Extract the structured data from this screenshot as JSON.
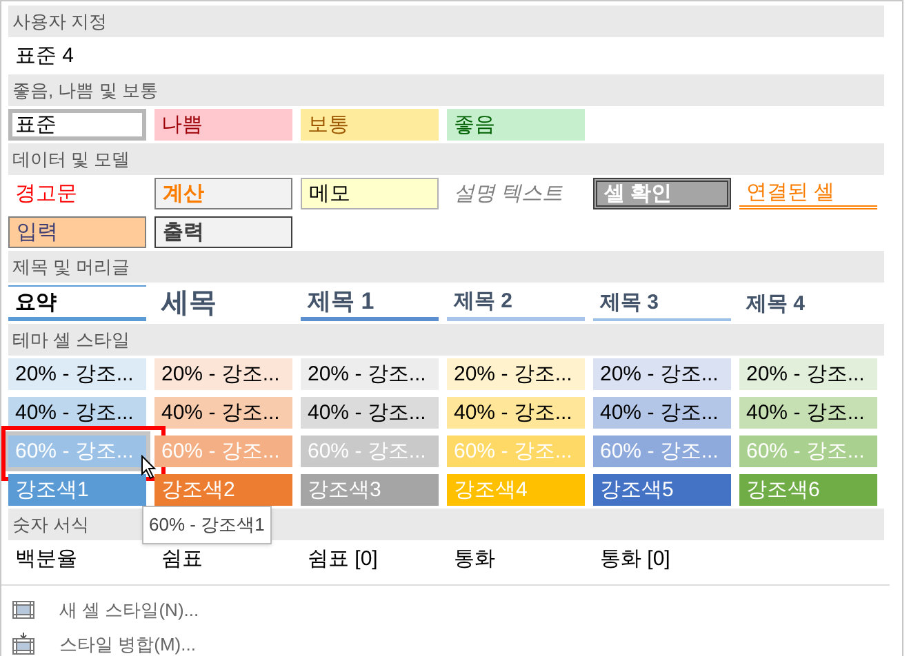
{
  "sections": [
    {
      "title": "사용자 지정",
      "items": [
        {
          "label": "표준 4",
          "kind": "plain",
          "selected": false,
          "hovered": false
        }
      ]
    },
    {
      "title": "좋음, 나쁨 및 보통",
      "items": [
        {
          "label": "표준",
          "kind": "normal",
          "selected": true,
          "hovered": false
        },
        {
          "label": "나쁨",
          "kind": "bad",
          "selected": false,
          "hovered": false
        },
        {
          "label": "보통",
          "kind": "neutral",
          "selected": false,
          "hovered": false
        },
        {
          "label": "좋음",
          "kind": "good",
          "selected": false,
          "hovered": false
        }
      ]
    },
    {
      "title": "데이터 및 모델",
      "items": [
        {
          "label": "경고문",
          "kind": "warning",
          "selected": false,
          "hovered": false
        },
        {
          "label": "계산",
          "kind": "calc",
          "selected": false,
          "hovered": false
        },
        {
          "label": "메모",
          "kind": "note",
          "selected": false,
          "hovered": false
        },
        {
          "label": "설명 텍스트",
          "kind": "explanatory",
          "selected": false,
          "hovered": false
        },
        {
          "label": "셀 확인",
          "kind": "check",
          "selected": false,
          "hovered": false
        },
        {
          "label": "연결된 셀",
          "kind": "linked",
          "selected": false,
          "hovered": false
        },
        {
          "label": "입력",
          "kind": "input",
          "selected": false,
          "hovered": false
        },
        {
          "label": "출력",
          "kind": "output",
          "selected": false,
          "hovered": false
        }
      ]
    },
    {
      "title": "제목 및 머리글",
      "items": [
        {
          "label": "요약",
          "kind": "total",
          "selected": false,
          "hovered": false
        },
        {
          "label": "세목",
          "kind": "title",
          "selected": false,
          "hovered": false
        },
        {
          "label": "제목 1",
          "kind": "h1",
          "selected": false,
          "hovered": false
        },
        {
          "label": "제목 2",
          "kind": "h2",
          "selected": false,
          "hovered": false
        },
        {
          "label": "제목 3",
          "kind": "h3",
          "selected": false,
          "hovered": false
        },
        {
          "label": "제목 4",
          "kind": "h4",
          "selected": false,
          "hovered": false
        }
      ]
    },
    {
      "title": "테마 셀 스타일",
      "items": [
        {
          "label": "20% - 강조...",
          "kind": "tint",
          "color": "#ddebf7",
          "selected": false,
          "hovered": false
        },
        {
          "label": "20% - 강조...",
          "kind": "tint",
          "color": "#fce4d6",
          "selected": false,
          "hovered": false
        },
        {
          "label": "20% - 강조...",
          "kind": "tint",
          "color": "#ededed",
          "selected": false,
          "hovered": false
        },
        {
          "label": "20% - 강조...",
          "kind": "tint",
          "color": "#fff2cc",
          "selected": false,
          "hovered": false
        },
        {
          "label": "20% - 강조...",
          "kind": "tint",
          "color": "#d9e1f2",
          "selected": false,
          "hovered": false
        },
        {
          "label": "20% - 강조...",
          "kind": "tint",
          "color": "#e2efda",
          "selected": false,
          "hovered": false
        },
        {
          "label": "40% - 강조...",
          "kind": "tint",
          "color": "#bdd7ee",
          "selected": false,
          "hovered": false
        },
        {
          "label": "40% - 강조...",
          "kind": "tint",
          "color": "#f8cbad",
          "selected": false,
          "hovered": false
        },
        {
          "label": "40% - 강조...",
          "kind": "tint",
          "color": "#dbdbdb",
          "selected": false,
          "hovered": false
        },
        {
          "label": "40% - 강조...",
          "kind": "tint",
          "color": "#ffe699",
          "selected": false,
          "hovered": false
        },
        {
          "label": "40% - 강조...",
          "kind": "tint",
          "color": "#b4c6e7",
          "selected": false,
          "hovered": false
        },
        {
          "label": "40% - 강조...",
          "kind": "tint",
          "color": "#c6e0b4",
          "selected": false,
          "hovered": false
        },
        {
          "label": "60% - 강조...",
          "kind": "shade",
          "color": "#9bc2e6",
          "selected": false,
          "hovered": true
        },
        {
          "label": "60% - 강조...",
          "kind": "shade",
          "color": "#f4b084",
          "selected": false,
          "hovered": false
        },
        {
          "label": "60% - 강조...",
          "kind": "shade",
          "color": "#c9c9c9",
          "selected": false,
          "hovered": false
        },
        {
          "label": "60% - 강조...",
          "kind": "shade",
          "color": "#ffd966",
          "selected": false,
          "hovered": false
        },
        {
          "label": "60% - 강조...",
          "kind": "shade",
          "color": "#8ea9db",
          "selected": false,
          "hovered": false
        },
        {
          "label": "60% - 강조...",
          "kind": "shade",
          "color": "#a9d08e",
          "selected": false,
          "hovered": false
        },
        {
          "label": "강조색1",
          "kind": "shade",
          "color": "#5b9bd5",
          "selected": false,
          "hovered": false
        },
        {
          "label": "강조색2",
          "kind": "shade",
          "color": "#ed7d31",
          "selected": false,
          "hovered": false
        },
        {
          "label": "강조색3",
          "kind": "shade",
          "color": "#a5a5a5",
          "selected": false,
          "hovered": false
        },
        {
          "label": "강조색4",
          "kind": "shade",
          "color": "#ffc000",
          "selected": false,
          "hovered": false
        },
        {
          "label": "강조색5",
          "kind": "shade",
          "color": "#4472c4",
          "selected": false,
          "hovered": false
        },
        {
          "label": "강조색6",
          "kind": "shade",
          "color": "#70ad47",
          "selected": false,
          "hovered": false
        }
      ]
    },
    {
      "title": "숫자 서식",
      "items": [
        {
          "label": "백분율",
          "kind": "plain",
          "selected": false,
          "hovered": false
        },
        {
          "label": "쉼표",
          "kind": "plain",
          "selected": false,
          "hovered": false
        },
        {
          "label": "쉼표 [0]",
          "kind": "plain",
          "selected": false,
          "hovered": false
        },
        {
          "label": "통화",
          "kind": "plain",
          "selected": false,
          "hovered": false
        },
        {
          "label": "통화 [0]",
          "kind": "plain",
          "selected": false,
          "hovered": false
        }
      ]
    }
  ],
  "tooltip": "60% - 강조색1",
  "menu": [
    {
      "label": "새 셀 스타일(N)...",
      "kind": "new"
    },
    {
      "label": "스타일 병합(M)...",
      "kind": "merge"
    }
  ]
}
